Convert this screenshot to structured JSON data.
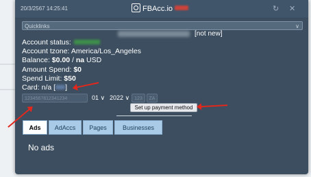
{
  "popup": {
    "timestamp": "20/3/2567 14:25:41",
    "app_name": "FBAcc.io",
    "window_controls": [
      "↻",
      "✕"
    ],
    "colors": {
      "background": "#3c4e5f",
      "titlebar": "#41556a",
      "accent_tab": "#a9cbe7",
      "annotation": "#e2281d"
    }
  },
  "selector": {
    "value": "Quicklinks"
  },
  "account": {
    "tag": "[not new]",
    "status_label": "Account status:",
    "tzone_label": "Account tzone:",
    "tzone_value": "America/Los_Angeles",
    "balance_label": "Balance:",
    "balance_value": "$0.00",
    "balance_sep": " / ",
    "balance_na": "na",
    "balance_currency": " USD",
    "spend_label": "Amount Spend:",
    "spend_value": "$0",
    "limit_label": "Spend Limit:",
    "limit_value": "$50",
    "card_label": "Card:",
    "card_value": "n/a",
    "card_open": " [",
    "card_close": "]"
  },
  "card_form": {
    "number_placeholder": "1234567812341234",
    "month": "01",
    "year": "2022",
    "cvv_placeholder": "123",
    "zip_placeholder": "ZA",
    "chevron": "∨",
    "setup_button": "Set up payment method"
  },
  "tabs": [
    {
      "label": "Ads",
      "active": true
    },
    {
      "label": "AdAccs",
      "active": false
    },
    {
      "label": "Pages",
      "active": false
    },
    {
      "label": "Businesses",
      "active": false
    }
  ],
  "content": {
    "empty_message": "No ads"
  }
}
